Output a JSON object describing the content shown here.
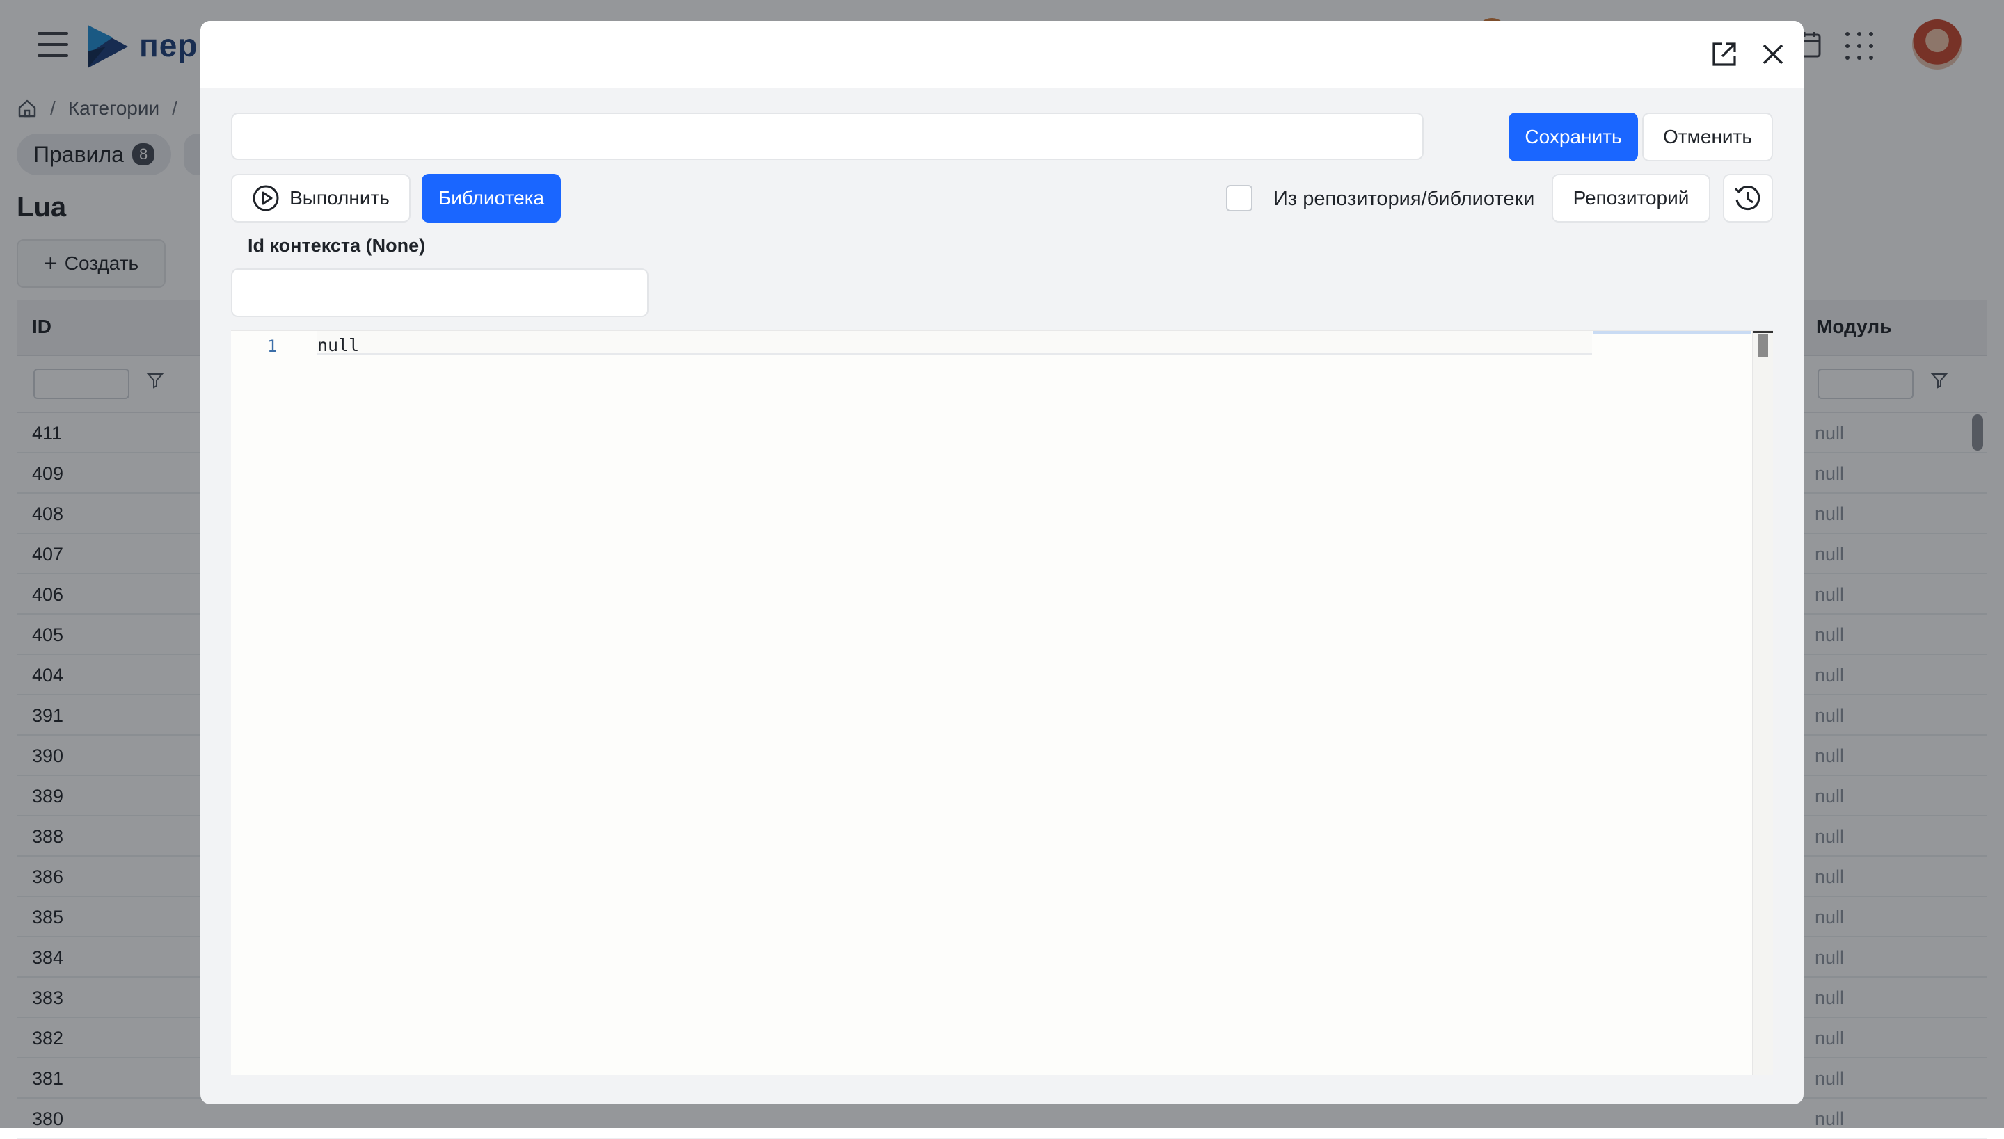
{
  "app": {
    "brand": "пер",
    "breadcrumb": {
      "root_icon": "home-icon",
      "items": [
        "Категории",
        ""
      ]
    },
    "tabs": [
      {
        "label": "Правила",
        "count": "8"
      }
    ],
    "page_title": "Lua",
    "create_label": "Создать",
    "table": {
      "columns": {
        "id": "ID",
        "module": "Модуль"
      },
      "rows": [
        {
          "id": "411",
          "module": "null"
        },
        {
          "id": "409",
          "module": "null"
        },
        {
          "id": "408",
          "module": "null"
        },
        {
          "id": "407",
          "module": "null"
        },
        {
          "id": "406",
          "module": "null"
        },
        {
          "id": "405",
          "module": "null"
        },
        {
          "id": "404",
          "module": "null"
        },
        {
          "id": "391",
          "module": "null"
        },
        {
          "id": "390",
          "module": "null"
        },
        {
          "id": "389",
          "module": "null"
        },
        {
          "id": "388",
          "module": "null"
        },
        {
          "id": "386",
          "module": "null"
        },
        {
          "id": "385",
          "module": "null"
        },
        {
          "id": "384",
          "module": "null"
        },
        {
          "id": "383",
          "module": "null"
        },
        {
          "id": "382",
          "module": "null"
        },
        {
          "id": "381",
          "module": "null"
        },
        {
          "id": "380",
          "module": "null"
        }
      ]
    }
  },
  "modal": {
    "icons": {
      "open_external": "external-link-icon",
      "close": "close-icon",
      "run": "play-circle-icon",
      "history": "history-icon"
    },
    "name_input": {
      "value": "",
      "placeholder": ""
    },
    "save_label": "Сохранить",
    "cancel_label": "Отменить",
    "run_label": "Выполнить",
    "library_label": "Библиотека",
    "from_repo_label": "Из репозитория/библиотеки",
    "from_repo_checked": false,
    "repository_label": "Репозиторий",
    "context_label": "Id контекста (None)",
    "context_input": {
      "value": "",
      "placeholder": ""
    },
    "editor": {
      "line_numbers": [
        "1"
      ],
      "lines": [
        "null"
      ]
    }
  },
  "colors": {
    "primary": "#1a66ff",
    "overlay": "rgba(20,24,30,0.45)",
    "muted_text": "#8f95a0"
  }
}
